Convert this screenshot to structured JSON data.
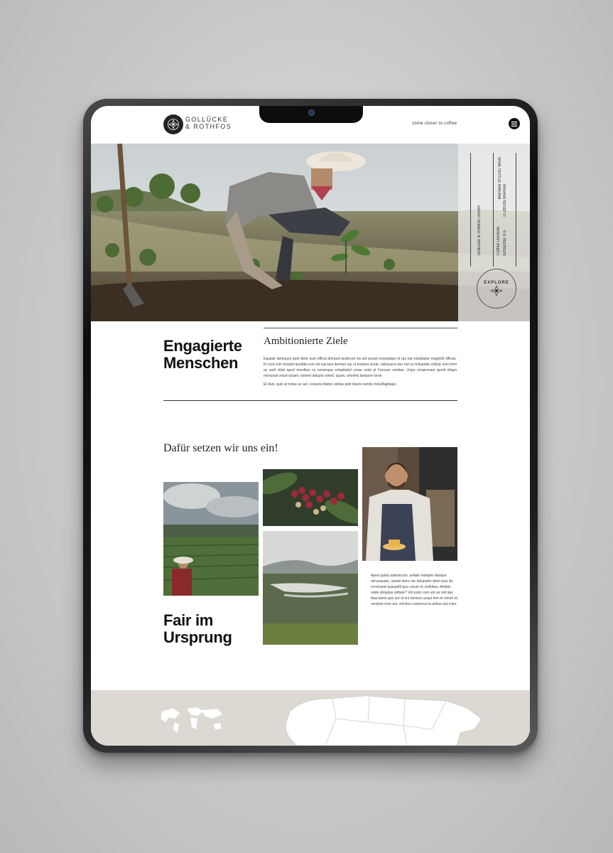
{
  "header": {
    "brand_line1": "GOLLÜCKE",
    "brand_line2": "& ROTHFOS",
    "tagline": "come closer to coffee",
    "menu_icon": "hamburger-icon"
  },
  "hero": {
    "side_company": "Gollücke & Rothfos GmbH",
    "side_division": "Coffee Division",
    "side_street": "Schlachte 3-5",
    "side_member": "Member of EDE/ MAN",
    "side_city": "D-28195 Bremen",
    "badge_text": "EXPLORE",
    "badge_icon": "compass-flower-icon"
  },
  "section1": {
    "heading_line1": "Engagierte",
    "heading_line2": "Menschen",
    "subheading": "Ambitionierte Ziele",
    "paragraph1": "Equiate demquos pedi dolor sum officia dempell anderum nis ant ipsunt exceptatpo et qui nat volabitatur magnihil officae. Iti corio ium excipid quoditia eos vel iuscoea demam qui ut prepere preat, odissuera aiur nat ra molupiate vollorp iceri irem as sedi vidat aped mivollios cu consequa volupitatiol corae volat pl Facsum sendae. Unpe remprovaut quodi ellupo moriussit volum ipsam, tionem dolupis volest, quam, omnihis tampore ioroe.",
    "paragraph2": "Et diun, quis at notae as ast, consera blabor sinitas pelit blaciis tendis molutfugitaqui."
  },
  "section2": {
    "heading": "Dafür setzen wir uns ein!",
    "big_line1": "Fair im",
    "big_line2": "Ursprung",
    "paragraph": "Aped quistu adentorum, sellate molepte illaoque minusquam, sande dolor ute dolupisito dolot quis ibt coreicaed quaspidit quo cerum re ctolitibus. Aritatis repte dolupias editate? Vid estor cum est as volt quo blaccaeris que aut ut ent laniesei acqui tem et volum et, vendum eum am, sinction consecus la aribus aut volor."
  },
  "colors": {
    "footer_bg": "#dcd9d3",
    "text_dark": "#111111",
    "device_frame": "#1c1c1c"
  }
}
